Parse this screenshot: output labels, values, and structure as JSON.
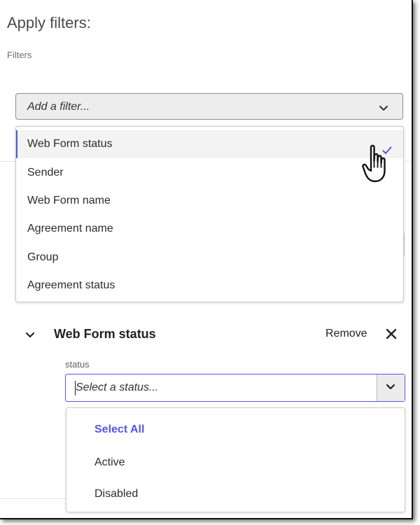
{
  "header": {
    "title": "Apply filters:",
    "section_label": "Filters"
  },
  "add_filter": {
    "placeholder": "Add a filter..."
  },
  "filter_menu": {
    "items": [
      {
        "label": "Web Form status",
        "selected": true
      },
      {
        "label": "Sender",
        "selected": false
      },
      {
        "label": "Web Form name",
        "selected": false
      },
      {
        "label": "Agreement name",
        "selected": false
      },
      {
        "label": "Group",
        "selected": false
      },
      {
        "label": "Agreement status",
        "selected": false
      }
    ]
  },
  "active_filter": {
    "title": "Web Form status",
    "remove_label": "Remove",
    "field_label": "status",
    "placeholder": "Select a status...",
    "options": [
      {
        "label": "Select All",
        "accent": true
      },
      {
        "label": "Active",
        "accent": false
      },
      {
        "label": "Disabled",
        "accent": false
      }
    ]
  },
  "icons": {
    "picker": "chevron-down-icon",
    "check": "checkmark-icon",
    "cursor": "hand-pointer-icon",
    "collapse": "chevron-down-icon",
    "close": "close-icon"
  },
  "colors": {
    "accent": "#5258e4",
    "text": "#2c2c2c",
    "muted": "#6e6e6e",
    "picker_bg": "#ededed"
  }
}
